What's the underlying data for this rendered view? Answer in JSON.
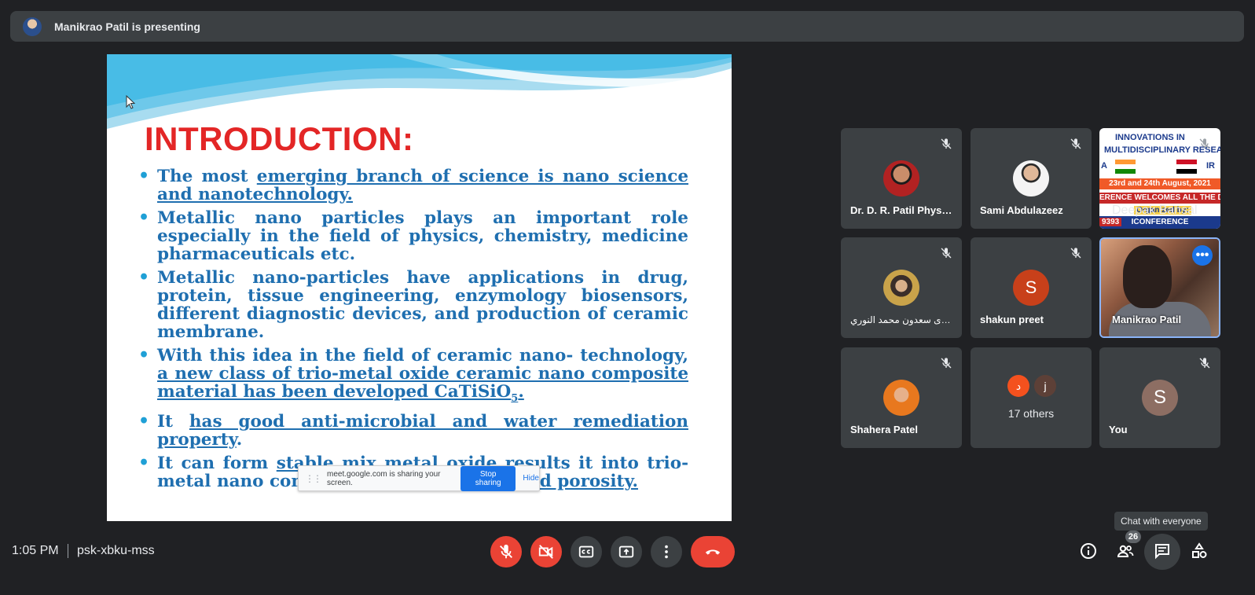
{
  "banner": {
    "text": "Manikrao Patil is presenting"
  },
  "slide": {
    "title": "INTRODUCTION:",
    "bullets": {
      "b1_a": "The most ",
      "b1_u": "emerging branch of science is nano science and nanotechnology.",
      "b2": "Metallic nano particles plays an important role especially in the field of physics, chemistry, medicine pharmaceuticals etc.",
      "b3": "Metallic nano-particles have applications in drug, protein, tissue engineering, enzymology biosensors, different diagnostic devices, and production of ceramic membrane.",
      "b4_a": "With this idea in the field of ceramic nano- technology, ",
      "b4_u": "a new class of trio-metal oxide ceramic nano composite material has been developed CaTiSiO",
      "b4_sub": "5",
      "b4_end": ".",
      "b5_a": "It ",
      "b5_u": "has good anti-microbial and water remediation property",
      "b5_end": ".",
      "b6_a": "It can form ",
      "b6_u1": "stable mix metal oxide ",
      "b6_b": "results it into trio-metal nano composite material ",
      "b6_u2": "with good porosity."
    },
    "share_bar": {
      "message": "meet.google.com is sharing your screen.",
      "stop_label": "Stop sharing",
      "hide_label": "Hide"
    }
  },
  "participants": [
    {
      "name": "Dr. D. R. Patil Physics"
    },
    {
      "name": "Sami Abdulazeez"
    },
    {
      "name": "Deepak Bansal"
    },
    {
      "name": "بشرى سعدون محمد النوري"
    },
    {
      "name": "shakun preet",
      "initial": "S"
    },
    {
      "name": "Manikrao Patil"
    },
    {
      "name": "Shahera Patel"
    },
    {
      "name": "17 others",
      "initials": [
        "د",
        "j"
      ]
    },
    {
      "name": "You",
      "initial": "S"
    }
  ],
  "conference_tile": {
    "line1": "INNOVATIONS IN",
    "line2": "MULTIDISCIPLINARY RESEA",
    "dates": "23rd and 24th August, 2021",
    "welcome": "ERENCE WELCOMES ALL THE DELE",
    "organized": "Organized by:",
    "code": "9393",
    "footer": "ICONFERENCE",
    "left_letter": "A",
    "right_letter": "IR"
  },
  "bottom_bar": {
    "time": "1:05 PM",
    "meeting_code": "psk-xbku-mss",
    "people_count": "26",
    "tooltip": "Chat with everyone"
  },
  "colors": {
    "background": "#202124",
    "tile": "#3c4043",
    "danger": "#ea4335",
    "accent": "#1a73e8"
  }
}
